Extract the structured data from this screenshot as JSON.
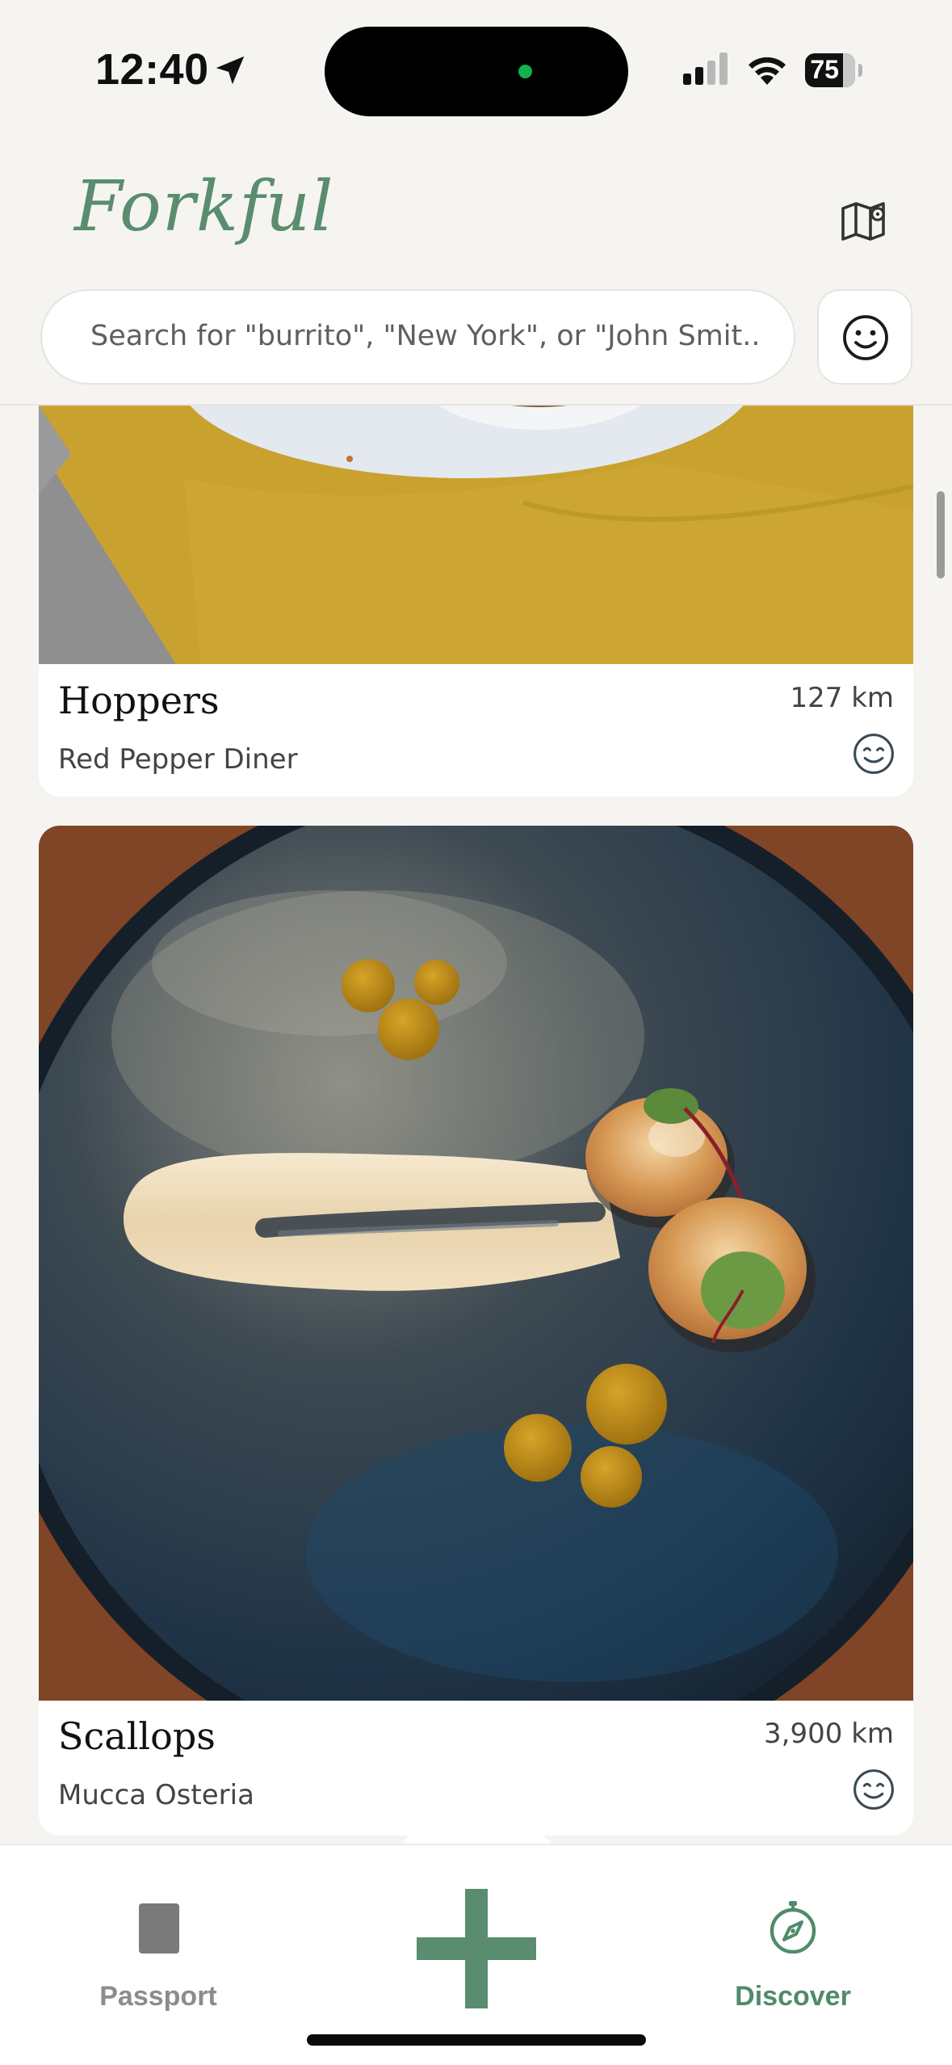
{
  "status_bar": {
    "time": "12:40",
    "battery": "75",
    "battery_level": 0.75,
    "icons": [
      "location-arrow-icon",
      "cellular-signal-icon",
      "wifi-icon",
      "battery-icon"
    ]
  },
  "header": {
    "logo": "Forkful",
    "search_placeholder": "Search for \"burrito\", \"New York\", or \"John Smit...",
    "icons": [
      "map-icon",
      "smiley-icon"
    ]
  },
  "feed": {
    "items": [
      {
        "dish": "Hoppers",
        "restaurant": "Red Pepper Diner",
        "distance": "127 km",
        "rating_icon": "smiling-face-icon"
      },
      {
        "dish": "Scallops",
        "restaurant": "Mucca Osteria",
        "distance": "3,900 km",
        "rating_icon": "smiling-face-icon"
      }
    ]
  },
  "tab_bar": {
    "tabs": [
      {
        "label": "Passport",
        "icon": "passport-icon",
        "active": false
      },
      {
        "label": "Discover",
        "icon": "compass-icon",
        "active": true
      }
    ],
    "add_icon": "plus-icon"
  },
  "colors": {
    "brand_green": "#5a8c6f",
    "background": "#f5f4f1",
    "active_tab": "#4f8b6a",
    "inactive_tab": "#8c8c8c"
  }
}
